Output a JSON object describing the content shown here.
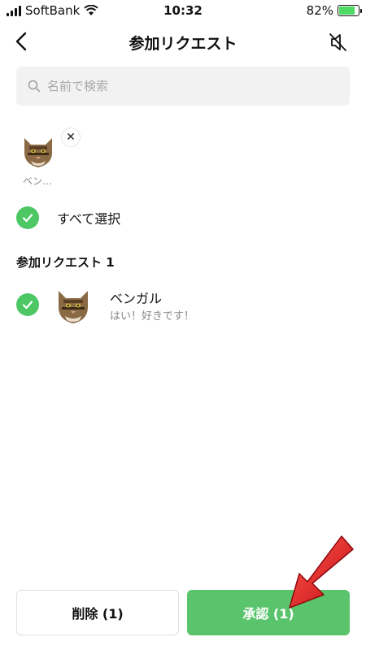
{
  "status_bar": {
    "carrier": "SoftBank",
    "time": "10:32",
    "battery": "82%",
    "battery_level": 0.82
  },
  "header": {
    "title": "参加リクエスト",
    "back_icon": "chevron-left-icon",
    "mute_icon": "speaker-muted-icon"
  },
  "search": {
    "placeholder": "名前で検索",
    "value": ""
  },
  "selected": [
    {
      "name": "ベン…"
    }
  ],
  "select_all": {
    "label": "すべて選択",
    "checked": true
  },
  "section": {
    "title": "参加リクエスト 1"
  },
  "requests": [
    {
      "name": "ベンガル",
      "message": "はい！好きです！",
      "checked": true
    }
  ],
  "buttons": {
    "delete": "削除 (1)",
    "approve": "承認 (1)"
  },
  "colors": {
    "accent": "#4cc764",
    "approve_button": "#5ac46c",
    "annotation_arrow": "#e8141e"
  }
}
